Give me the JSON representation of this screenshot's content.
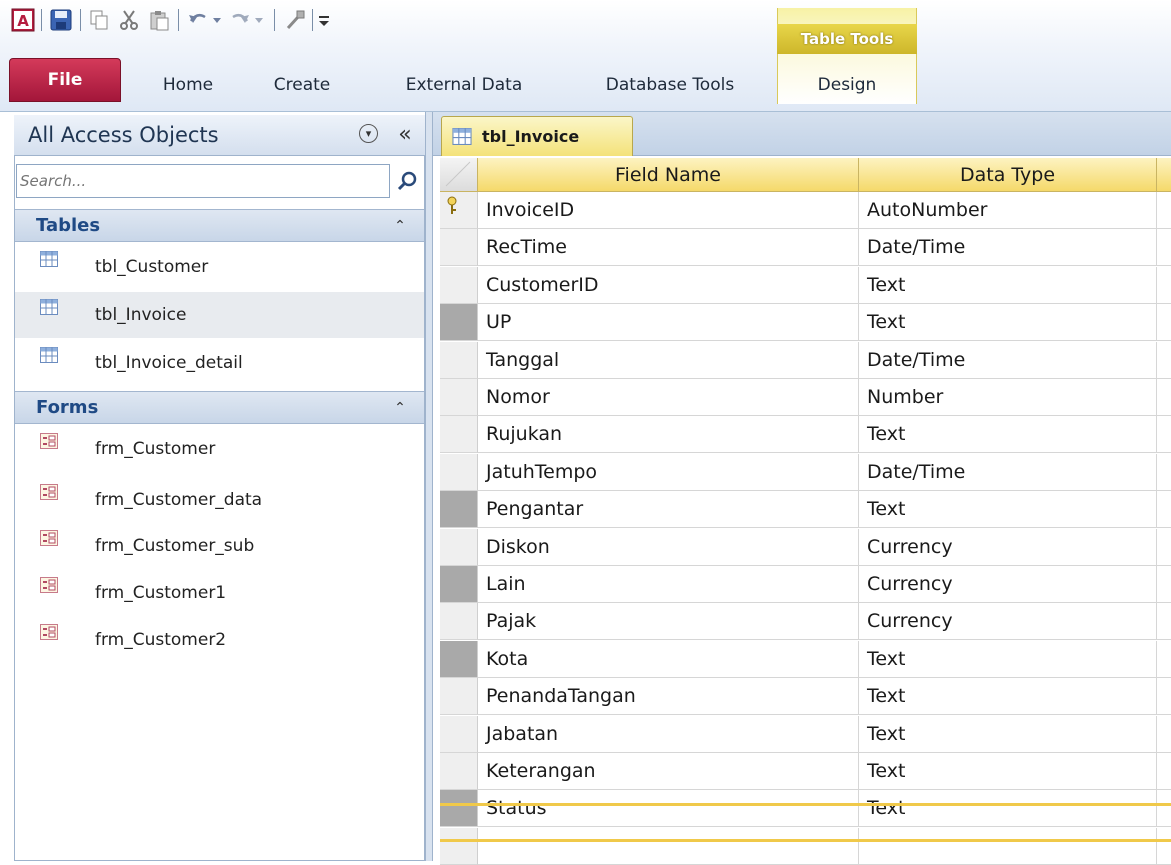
{
  "ribbon": {
    "qat_icons": [
      "access-logo-icon",
      "save-icon",
      "copy-icon",
      "cut-icon",
      "paste-icon",
      "undo-icon",
      "redo-icon",
      "format-painter-icon",
      "customize-qat-icon"
    ],
    "file_tab": "File",
    "tabs": [
      "Home",
      "Create",
      "External Data",
      "Database Tools"
    ],
    "contextual_group": "Table Tools",
    "contextual_tab": "Design",
    "colors": {
      "file_tab": "#b21f44",
      "contextual": "#e8d64a"
    }
  },
  "nav": {
    "title": "All Access Objects",
    "search_placeholder": "Search...",
    "groups": [
      {
        "label": "Tables",
        "items": [
          "tbl_Customer",
          "tbl_Invoice",
          "tbl_Invoice_detail"
        ],
        "selected": "tbl_Invoice"
      },
      {
        "label": "Forms",
        "items": [
          "frm_Customer",
          "frm_Customer_data",
          "frm_Customer_sub",
          "frm_Customer1",
          "frm_Customer2"
        ]
      }
    ]
  },
  "document": {
    "tab_label": "tbl_Invoice",
    "columns": {
      "field_name": "Field Name",
      "data_type": "Data Type"
    },
    "fields": [
      {
        "name": "InvoiceID",
        "type": "AutoNumber",
        "primary_key": true
      },
      {
        "name": "RecTime",
        "type": "Date/Time"
      },
      {
        "name": "CustomerID",
        "type": "Text"
      },
      {
        "name": "UP",
        "type": "Text"
      },
      {
        "name": "Tanggal",
        "type": "Date/Time"
      },
      {
        "name": "Nomor",
        "type": "Number"
      },
      {
        "name": "Rujukan",
        "type": "Text"
      },
      {
        "name": "JatuhTempo",
        "type": "Date/Time"
      },
      {
        "name": "Pengantar",
        "type": "Text"
      },
      {
        "name": "Diskon",
        "type": "Currency"
      },
      {
        "name": "Lain",
        "type": "Currency"
      },
      {
        "name": "Pajak",
        "type": "Currency"
      },
      {
        "name": "Kota",
        "type": "Text"
      },
      {
        "name": "PenandaTangan",
        "type": "Text"
      },
      {
        "name": "Jabatan",
        "type": "Text"
      },
      {
        "name": "Keterangan",
        "type": "Text"
      },
      {
        "name": "Status",
        "type": "Text",
        "current": true
      }
    ]
  }
}
